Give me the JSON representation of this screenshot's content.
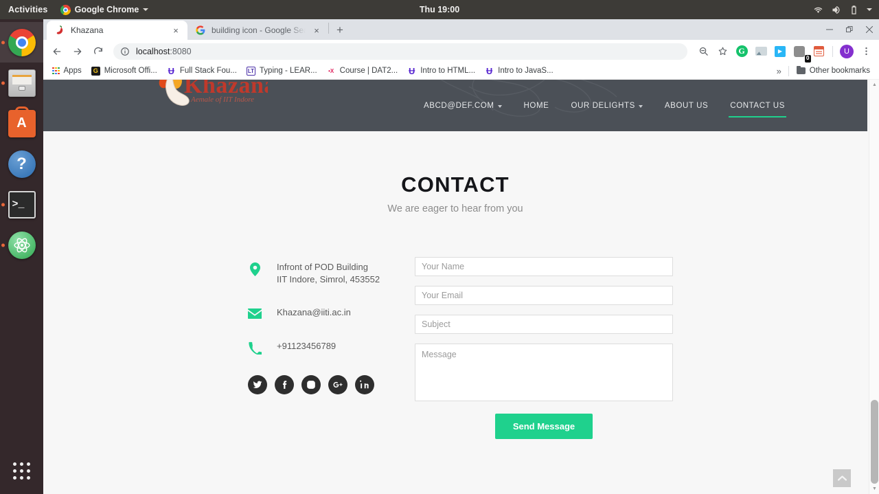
{
  "os": {
    "activities": "Activities",
    "app_menu": "Google Chrome",
    "clock": "Thu 19:00",
    "tray_icons": [
      "wifi-icon",
      "volume-icon",
      "battery-icon",
      "chevron-down-icon"
    ],
    "dock": [
      {
        "name": "google-chrome",
        "label": "Google Chrome",
        "running": true,
        "active": true
      },
      {
        "name": "files",
        "label": "Files",
        "running": true,
        "active": false
      },
      {
        "name": "ubuntu-software",
        "label": "Ubuntu Software",
        "running": false,
        "active": false,
        "glyph": "A"
      },
      {
        "name": "help",
        "label": "Help",
        "running": false,
        "active": false,
        "glyph": "?"
      },
      {
        "name": "terminal",
        "label": "Terminal",
        "running": true,
        "active": false,
        "glyph": ">_"
      },
      {
        "name": "atom",
        "label": "Atom",
        "running": true,
        "active": false
      }
    ],
    "show_apps_label": "Show Applications"
  },
  "browser": {
    "tabs": [
      {
        "title": "Khazana",
        "favicon": "chili-pepper-icon",
        "active": true,
        "close_label": "×"
      },
      {
        "title": "building icon - Google Sea",
        "favicon": "google-icon",
        "active": false,
        "close_label": "×"
      }
    ],
    "new_tab_label": "+",
    "window_controls": [
      "minimize",
      "maximize",
      "close"
    ],
    "nav": {
      "back": "back-arrow-icon",
      "forward": "forward-arrow-icon",
      "reload": "reload-icon"
    },
    "omnibox": {
      "security_icon": "info-circle-icon",
      "host": "localhost",
      "rest": ":8080",
      "full": "localhost:8080"
    },
    "toolbar_icons": [
      {
        "name": "zoom-out-icon"
      },
      {
        "name": "bookmark-star-icon"
      },
      {
        "name": "grammarly-extension-icon",
        "glyph": "G"
      },
      {
        "name": "image-extension-icon"
      },
      {
        "name": "blue-arrow-extension-icon"
      },
      {
        "name": "badge-extension-icon",
        "badge": "0"
      },
      {
        "name": "notes-extension-icon"
      }
    ],
    "avatar_initial": "U",
    "menu_icon": "kebab-menu-icon",
    "bookmarks": [
      {
        "label": "Apps",
        "icon": "apps-grid-icon"
      },
      {
        "label": "Microsoft Offi...",
        "icon": "ms-office-icon",
        "glyph": "G"
      },
      {
        "label": "Full Stack Fou...",
        "icon": "udemy-icon",
        "glyph": "Ʉ"
      },
      {
        "label": "Typing - LEAR...",
        "icon": "lt-icon",
        "glyph": "LT"
      },
      {
        "label": "Course | DAT2...",
        "icon": "ex-icon",
        "glyph": "•X"
      },
      {
        "label": "Intro to HTML...",
        "icon": "udemy-icon",
        "glyph": "Ʉ"
      },
      {
        "label": "Intro to JavaS...",
        "icon": "udemy-icon",
        "glyph": "Ʉ"
      }
    ],
    "bookmarks_overflow": "»",
    "other_bookmarks": {
      "label": "Other bookmarks",
      "icon": "folder-icon"
    }
  },
  "site": {
    "logo": {
      "name": "Khazana",
      "tagline": "Aemale of IIT Indore"
    },
    "nav": [
      {
        "label": "ABCD@DEF.COM",
        "has_caret": true,
        "active": false
      },
      {
        "label": "HOME",
        "has_caret": false,
        "active": false
      },
      {
        "label": "OUR DELIGHTS",
        "has_caret": true,
        "active": false
      },
      {
        "label": "ABOUT US",
        "has_caret": false,
        "active": false
      },
      {
        "label": "CONTACT US",
        "has_caret": false,
        "active": true
      }
    ],
    "header_bg": "#4b5057",
    "accent": "#1fd18d"
  },
  "contact": {
    "title": "CONTACT",
    "subtitle": "We are eager to hear from you",
    "address_line1": "Infront of POD Building",
    "address_line2": "IIT Indore, Simrol, 453552",
    "email": "Khazana@iiti.ac.in",
    "phone": "+91123456789",
    "socials": [
      {
        "name": "twitter-icon",
        "label": "Twitter"
      },
      {
        "name": "facebook-icon",
        "label": "Facebook"
      },
      {
        "name": "instagram-icon",
        "label": "Instagram"
      },
      {
        "name": "google-plus-icon",
        "label": "Google Plus"
      },
      {
        "name": "linkedin-icon",
        "label": "LinkedIn"
      }
    ],
    "form": {
      "name_placeholder": "Your Name",
      "name_value": "",
      "email_placeholder": "Your Email",
      "email_value": "",
      "subject_placeholder": "Subject",
      "subject_value": "",
      "message_placeholder": "Message",
      "message_value": "",
      "submit_label": "Send Message"
    },
    "scroll_top_label": "⌃"
  }
}
